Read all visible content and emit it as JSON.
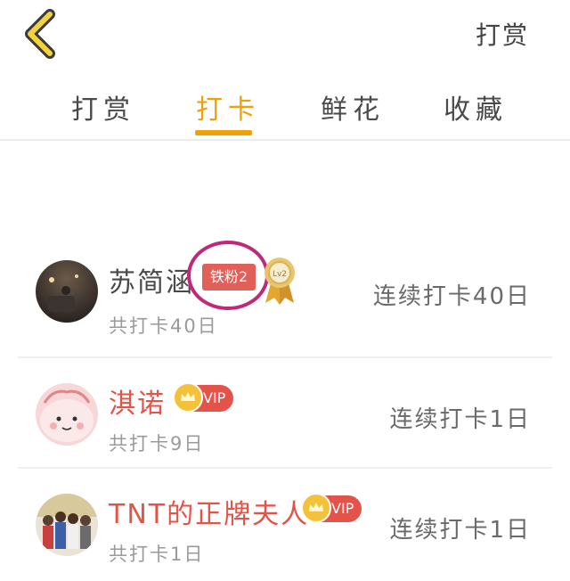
{
  "header": {
    "right_action": "打赏"
  },
  "tabs": [
    {
      "label": "打赏",
      "active": false
    },
    {
      "label": "打卡",
      "active": true
    },
    {
      "label": "鲜花",
      "active": false
    },
    {
      "label": "收藏",
      "active": false
    }
  ],
  "colors": {
    "accent": "#f0a00a",
    "name_red": "#e55347",
    "badge_red": "#e2605a",
    "circle_mark": "#c0287a",
    "crown_gold": "#f4c23a"
  },
  "list": [
    {
      "name": "苏简涵",
      "fan_badge": "铁粉2",
      "medal_icon": "gold-medal-icon",
      "total": "共打卡40日",
      "streak": "连续打卡40日"
    },
    {
      "name": "淇诺",
      "vip": "VIP",
      "total": "共打卡9日",
      "streak": "连续打卡1日"
    },
    {
      "name": "TNT的正牌夫人",
      "vip": "VIP",
      "total": "共打卡1日",
      "streak": "连续打卡1日"
    }
  ]
}
